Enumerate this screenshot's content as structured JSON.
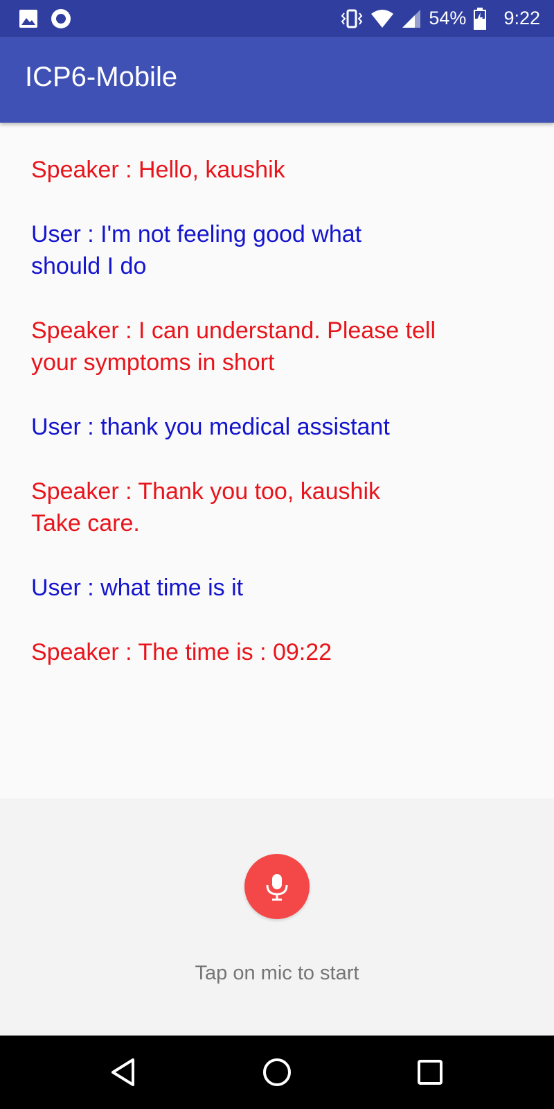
{
  "status_bar": {
    "battery": "54%",
    "time": "9:22",
    "icons": [
      "image-icon",
      "record-icon",
      "vibrate-icon",
      "wifi-icon",
      "signal-icon",
      "battery-icon"
    ]
  },
  "app_bar": {
    "title": "ICP6-Mobile"
  },
  "colors": {
    "speaker": "#e8141b",
    "user": "#1414cc",
    "app_bar": "#3f51b5",
    "status_bar": "#303f9f",
    "mic": "#f44848"
  },
  "conversation": [
    {
      "role": "speaker",
      "text": "Speaker : Hello, kaushik"
    },
    {
      "role": "user",
      "text": "User : I'm not feeling good what\nshould I do"
    },
    {
      "role": "speaker",
      "text": "Speaker : I can understand. Please tell\nyour symptoms in short"
    },
    {
      "role": "user",
      "text": "User : thank you medical assistant"
    },
    {
      "role": "speaker",
      "text": "Speaker : Thank you too, kaushik\nTake care."
    },
    {
      "role": "user",
      "text": "User : what time is it"
    },
    {
      "role": "speaker",
      "text": "Speaker : The time is : 09:22"
    }
  ],
  "mic": {
    "icon": "microphone-icon",
    "hint": "Tap on mic to start"
  },
  "nav": {
    "icons": [
      "back-icon",
      "home-icon",
      "recents-icon"
    ]
  }
}
